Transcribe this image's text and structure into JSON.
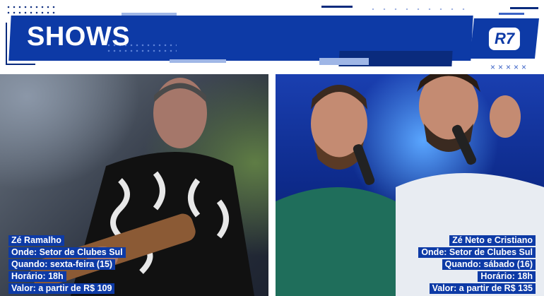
{
  "header": {
    "title": "SHOWS",
    "logo_text": "R7",
    "crosses": "×××××",
    "brand_color": "#0d3aa6"
  },
  "shows": [
    {
      "artist": "Zé Ramalho",
      "where": "Onde: Setor de Clubes Sul",
      "when": "Quando: sexta-feira (15)",
      "time": "Horário: 18h",
      "price": "Valor: a partir de R$ 109"
    },
    {
      "artist": "Zé Neto e Cristiano",
      "where": "Onde: Setor de Clubes Sul",
      "when": "Quando: sábado (16)",
      "time": "Horário: 18h",
      "price": "Valor: a partir de R$ 135"
    }
  ]
}
